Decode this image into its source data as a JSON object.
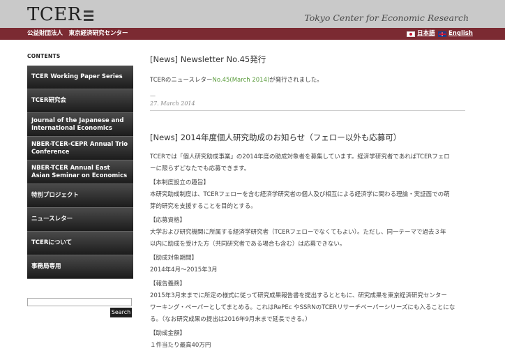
{
  "header": {
    "logo_text": "TCER",
    "tagline": "Tokyo Center for Economic Research"
  },
  "redbar": {
    "org_name": "公益財団法人　東京経済研究センター",
    "lang_ja": "日本語",
    "lang_en": "English"
  },
  "sidebar": {
    "contents_title": "CONTENTS",
    "items": [
      {
        "label": "TCER Working Paper Series"
      },
      {
        "label": "TCER研究会"
      },
      {
        "label": "Journal of the Japanese and International Economics"
      },
      {
        "label": "NBER-TCER-CEPR Annual Trio Conference"
      },
      {
        "label": "NBER-TCER Annual East Asian Seminar on Economics"
      },
      {
        "label": "特別プロジェクト"
      },
      {
        "label": "ニュースレター"
      },
      {
        "label": "TCERについて"
      },
      {
        "label": "事務局専用"
      }
    ],
    "search_button": "Search",
    "search_value": ""
  },
  "post1": {
    "title": "[News] Newsletter No.45発行",
    "text_before": "TCERのニュースレター",
    "link": "No.45(March 2014)",
    "text_after": "が発行されました。",
    "dash": "—",
    "date": "27. March 2014"
  },
  "post2": {
    "title": "[News] 2014年度個人研究助成のお知らせ（フェロー以外も応募可）",
    "intro_1": "TCERでは「個人研究助成事業」の2014年度の助成対象者を募集しています。経済学研究者であればTCERフェロ",
    "intro_2": "ーに限らずどなたでも応募できます。",
    "s1_head": "【本制度設立の趣旨】",
    "s1_1": "本研究助成制度は、TCERフェローを含む経済学研究者の個人及び相互による経済学に関わる理論・実証面での萌",
    "s1_2": "芽的研究を支援することを目的とする。",
    "s2_head": "【応募資格】",
    "s2_1": "大学および研究機関に所属する経済学研究者（TCERフェローでなくてもよい）。ただし、同一テーマで過去３年",
    "s2_2": "以内に助成を受けた方（共同研究者である場合も含む）は応募できない。",
    "s3_head": "【助成対象期間】",
    "s3_1": "2014年4月～2015年3月",
    "s4_head": "【報告義務】",
    "s4_1": "2015年3月末までに所定の様式に従って研究成果報告書を提出するとともに、研究成果を東京経済研究センター",
    "s4_2": "ワーキング・ペーパーとしてまとめる。これはRePEc やSSRNのTCERリサーチペーパーシリーズにも入ることにな",
    "s4_3": "る。（なお研究成果の提出は2016年9月末まで延長できる。）",
    "s5_head": "【助成金額】",
    "s5_1": "１件当たり最高40万円"
  }
}
